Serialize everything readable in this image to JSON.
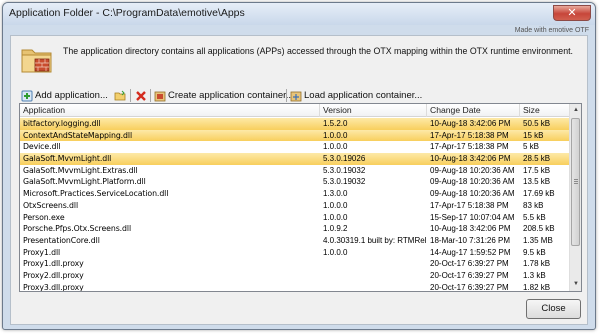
{
  "window": {
    "title": "Application Folder - C:\\ProgramData\\emotive\\Apps",
    "close_glyph": "✕",
    "made_with": "Made with emotive OTF"
  },
  "description": "The application directory contains all applications (APPs) accessed through the OTX mapping within the OTX runtime environment.",
  "toolbar": {
    "add_application": "Add application...",
    "create_container": "Create application container...",
    "load_container": "Load application container...",
    "icons": [
      "add-app-icon",
      "open-folder-icon",
      "delete-icon",
      "create-container-icon",
      "load-container-icon"
    ]
  },
  "table": {
    "columns": [
      "Application",
      "Version",
      "Change Date",
      "Size"
    ],
    "rows": [
      {
        "app": "bitfactory.logging.dll",
        "version": "1.5.2.0",
        "date": "10-Aug-18 3:42:06 PM",
        "size": "50.5 kB",
        "selected": true
      },
      {
        "app": "ContextAndStateMapping.dll",
        "version": "1.0.0.0",
        "date": "17-Apr-17 5:18:38 PM",
        "size": "15 kB",
        "selected": true
      },
      {
        "app": "Device.dll",
        "version": "1.0.0.0",
        "date": "17-Apr-17 5:18:38 PM",
        "size": "5 kB",
        "selected": false
      },
      {
        "app": "GalaSoft.MvvmLight.dll",
        "version": "5.3.0.19026",
        "date": "10-Aug-18 3:42:06 PM",
        "size": "28.5 kB",
        "selected": true
      },
      {
        "app": "GalaSoft.MvvmLight.Extras.dll",
        "version": "5.3.0.19032",
        "date": "09-Aug-18 10:20:36 AM",
        "size": "17.5 kB",
        "selected": false
      },
      {
        "app": "GalaSoft.MvvmLight.Platform.dll",
        "version": "5.3.0.19032",
        "date": "09-Aug-18 10:20:36 AM",
        "size": "13.5 kB",
        "selected": false
      },
      {
        "app": "Microsoft.Practices.ServiceLocation.dll",
        "version": "1.3.0.0",
        "date": "09-Aug-18 10:20:36 AM",
        "size": "17.69 kB",
        "selected": false
      },
      {
        "app": "OtxScreens.dll",
        "version": "1.0.0.0",
        "date": "17-Apr-17 5:18:38 PM",
        "size": "83 kB",
        "selected": false
      },
      {
        "app": "Person.exe",
        "version": "1.0.0.0",
        "date": "15-Sep-17 10:07:04 AM",
        "size": "5.5 kB",
        "selected": false
      },
      {
        "app": "Porsche.Pfps.Otx.Screens.dll",
        "version": "1.0.9.2",
        "date": "10-Aug-18 3:42:06 PM",
        "size": "208.5 kB",
        "selected": false
      },
      {
        "app": "PresentationCore.dll",
        "version": "4.0.30319.1 built by: RTMRel",
        "date": "18-Mar-10 7:31:26 PM",
        "size": "1.35 MB",
        "selected": false
      },
      {
        "app": "Proxy1.dll",
        "version": "1.0.0.0",
        "date": "14-Aug-17 1:59:52 PM",
        "size": "9.5 kB",
        "selected": false
      },
      {
        "app": "Proxy1.dll.proxy",
        "version": "",
        "date": "20-Oct-17 6:39:27 PM",
        "size": "1.78 kB",
        "selected": false
      },
      {
        "app": "Proxy2.dll.proxy",
        "version": "",
        "date": "20-Oct-17 6:39:27 PM",
        "size": "1.3 kB",
        "selected": false
      },
      {
        "app": "Proxy3.dll.proxy",
        "version": "",
        "date": "20-Oct-17 6:39:27 PM",
        "size": "1.82 kB",
        "selected": false
      }
    ]
  },
  "buttons": {
    "close": "Close"
  },
  "colors": {
    "selection": "#f8cf5d",
    "title_bar": "#c9d8ea",
    "close_x": "#c7463a"
  }
}
